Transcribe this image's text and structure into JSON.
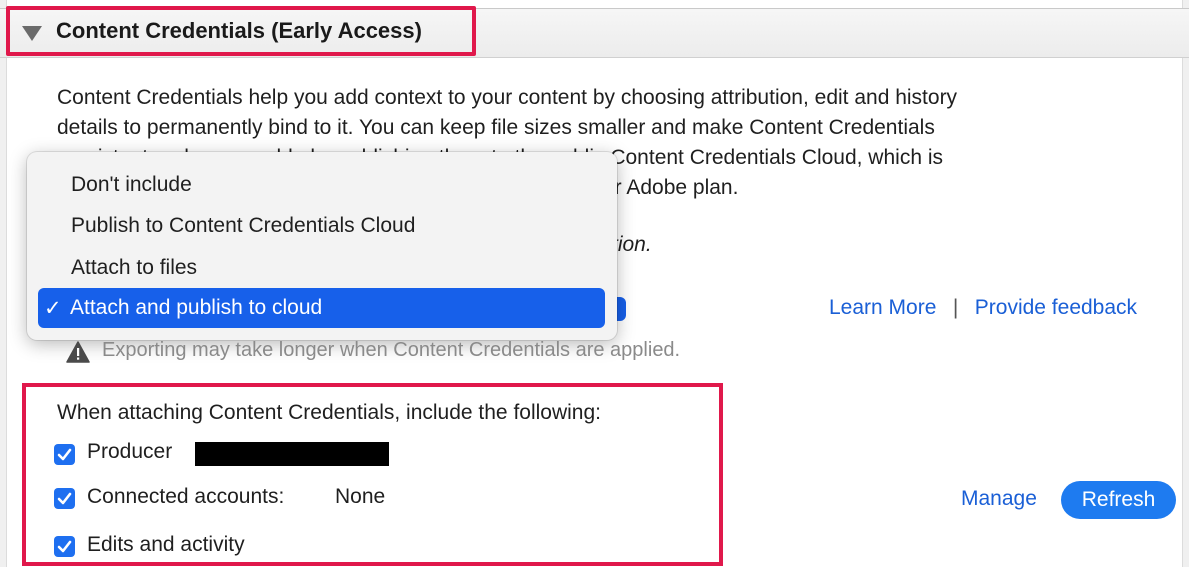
{
  "header": {
    "title": "Content Credentials (Early Access)"
  },
  "description": {
    "line1": "Content Credentials help you add context to your content by choosing attribution, edit and history",
    "line2": "details to permanently bind to it. You can keep file sizes smaller and make Content Credentials",
    "line3": "persistent and recoverable by publishing them to the public Content Credentials Cloud, which is",
    "line4_visible": "ur Adobe plan.",
    "line5_visible": "tion."
  },
  "dropdown": {
    "options": [
      "Don't include",
      "Publish to Content Credentials Cloud",
      "Attach to files",
      "Attach and publish to cloud"
    ],
    "selected_index": 3,
    "check_mark": "✓"
  },
  "links": {
    "learn_more": "Learn More",
    "separator": "|",
    "feedback": "Provide feedback"
  },
  "warning": {
    "icon": "warning-icon",
    "text": "Exporting may take longer when Content Credentials are applied."
  },
  "include_options": {
    "heading": "When attaching Content Credentials, include the following:",
    "producer": {
      "label": "Producer",
      "checked": true
    },
    "connected_accounts": {
      "label": "Connected accounts:",
      "value": "None",
      "checked": true
    },
    "edits": {
      "label": "Edits and activity",
      "checked": true
    }
  },
  "actions": {
    "manage": "Manage",
    "refresh": "Refresh"
  },
  "colors": {
    "accent": "#1760ea",
    "highlight_border": "#e0184b",
    "link": "#1a5fd6"
  }
}
